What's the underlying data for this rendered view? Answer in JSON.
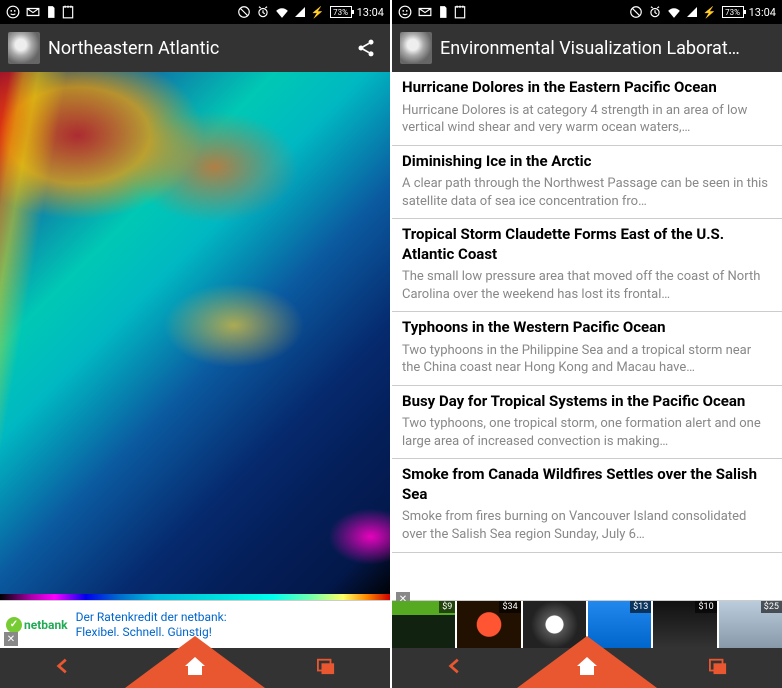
{
  "status": {
    "battery": "73%",
    "time": "13:04"
  },
  "left": {
    "title": "Northeastern Atlantic",
    "ad": {
      "brand": "netbank",
      "line1": "Der Ratenkredit der netbank:",
      "line2": "Flexibel. Schnell. Günstig!"
    }
  },
  "right": {
    "title": "Environmental Visualization Laborat…",
    "articles": [
      {
        "title": "Hurricane Dolores in the Eastern Pacific Ocean",
        "snippet": "Hurricane Dolores is at category 4 strength in an area of low vertical wind shear and very warm ocean waters,…"
      },
      {
        "title": "Diminishing Ice in the Arctic",
        "snippet": "A clear path through the Northwest Passage can be seen in this satellite data of sea ice concentration fro…"
      },
      {
        "title": "Tropical Storm Claudette Forms East of the U.S. Atlantic Coast",
        "snippet": "The small low pressure area that moved off the coast of North Carolina over the weekend has lost its frontal…"
      },
      {
        "title": "Typhoons in the Western Pacific Ocean",
        "snippet": "Two typhoons in the Philippine Sea and a tropical storm near the China coast near Hong Kong and Macau have…"
      },
      {
        "title": "Busy Day for Tropical Systems in the Pacific Ocean",
        "snippet": "Two typhoons, one tropical storm, one formation alert and one large area of increased convection is making…"
      },
      {
        "title": "Smoke from Canada Wildfires Settles over the Salish Sea",
        "snippet": "Smoke from fires burning on Vancouver Island consolidated over the Salish Sea region Sunday, July 6…"
      }
    ],
    "products": [
      {
        "price": "$9"
      },
      {
        "price": "$34"
      },
      {
        "price": ""
      },
      {
        "price": "$13"
      },
      {
        "price": "$10"
      },
      {
        "price": "$25"
      }
    ]
  }
}
